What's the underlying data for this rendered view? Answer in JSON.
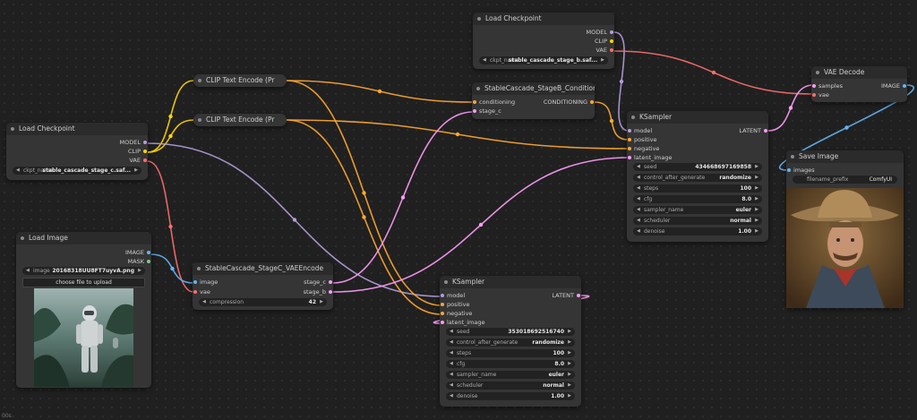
{
  "colors": {
    "model": "#b39ddb",
    "clip": "#ffd500",
    "vae": "#ff6e6e",
    "conditioning": "#ffa931",
    "latent": "#ff9cf9",
    "image": "#64b5f6",
    "mask": "#81c784"
  },
  "nodes": {
    "ckpt_left": {
      "title": "Load Checkpoint",
      "outputs": [
        "MODEL",
        "CLIP",
        "VAE"
      ],
      "widget": {
        "name": "ckpt_name",
        "value": "stable_cascade_stage_c.saf..."
      }
    },
    "ckpt_top": {
      "title": "Load Checkpoint",
      "outputs": [
        "MODEL",
        "CLIP",
        "VAE"
      ],
      "widget": {
        "name": "ckpt_name",
        "value": "stable_cascade_stage_b.saf..."
      }
    },
    "clip_pos": {
      "title": "CLIP Text Encode (Pr"
    },
    "clip_neg": {
      "title": "CLIP Text Encode (Pr"
    },
    "load_image": {
      "title": "Load Image",
      "outputs": [
        "IMAGE",
        "MASK"
      ],
      "widget": {
        "name": "image",
        "value": "20168318UU8FT7uyvA.png"
      },
      "button": "choose file to upload"
    },
    "stagec_vae": {
      "title": "StableCascade_StageC_VAEEncode",
      "inputs": [
        "image",
        "vae"
      ],
      "outputs": [
        "stage_c",
        "stage_b"
      ],
      "widget": {
        "name": "compression",
        "value": "42"
      }
    },
    "stageb_cond": {
      "title": "StableCascade_StageB_Conditioning",
      "inputs": [
        "conditioning",
        "stage_c"
      ],
      "outputs": [
        "CONDITIONING"
      ]
    },
    "ksampler_right": {
      "title": "KSampler",
      "inputs": [
        "model",
        "positive",
        "negative",
        "latent_image"
      ],
      "outputs": [
        "LATENT"
      ],
      "widgets": [
        {
          "name": "seed",
          "value": "434668697169858"
        },
        {
          "name": "control_after_generate",
          "value": "randomize"
        },
        {
          "name": "steps",
          "value": "100"
        },
        {
          "name": "cfg",
          "value": "8.0"
        },
        {
          "name": "sampler_name",
          "value": "euler"
        },
        {
          "name": "scheduler",
          "value": "normal"
        },
        {
          "name": "denoise",
          "value": "1.00"
        }
      ]
    },
    "ksampler_bottom": {
      "title": "KSampler",
      "inputs": [
        "model",
        "positive",
        "negative",
        "latent_image"
      ],
      "outputs": [
        "LATENT"
      ],
      "widgets": [
        {
          "name": "seed",
          "value": "353018692516740"
        },
        {
          "name": "control_after_generate",
          "value": "randomize"
        },
        {
          "name": "steps",
          "value": "100"
        },
        {
          "name": "cfg",
          "value": "8.0"
        },
        {
          "name": "sampler_name",
          "value": "euler"
        },
        {
          "name": "scheduler",
          "value": "normal"
        },
        {
          "name": "denoise",
          "value": "1.00"
        }
      ]
    },
    "vae_decode": {
      "title": "VAE Decode",
      "inputs": [
        "samples",
        "vae"
      ],
      "outputs": [
        "IMAGE"
      ]
    },
    "save_image": {
      "title": "Save Image",
      "inputs": [
        "images"
      ],
      "widget": {
        "name": "filename_prefix",
        "value": "ComfyUI"
      }
    }
  },
  "status": "00s"
}
